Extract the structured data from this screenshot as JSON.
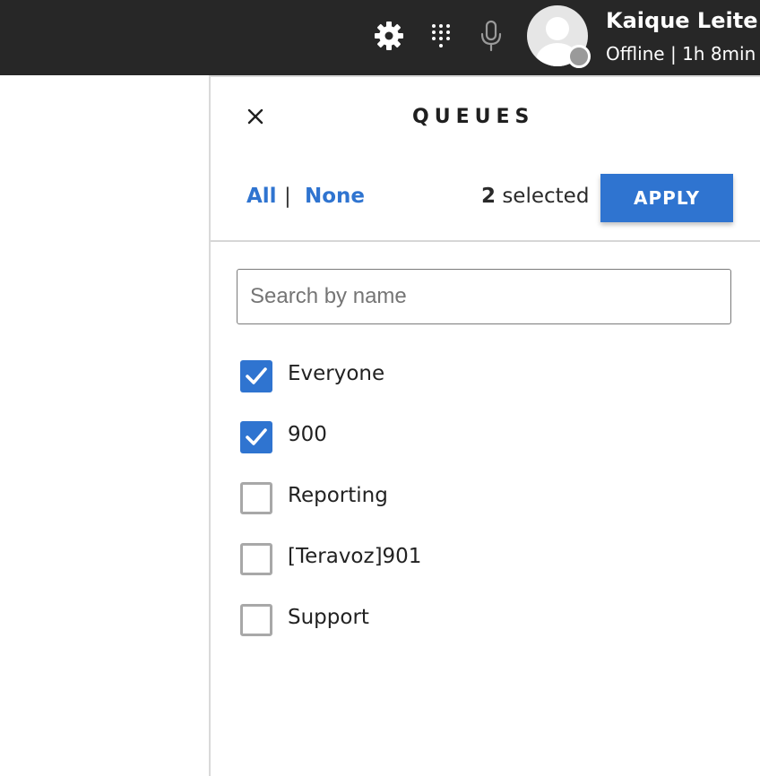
{
  "header": {
    "icons": [
      "gear-icon",
      "dialpad-icon",
      "microphone-icon"
    ],
    "user": {
      "name": "Kaique Leite",
      "status": "Offline | 1h 8min",
      "status_color": "#9a9a9a"
    }
  },
  "panel": {
    "title": "QUEUES",
    "close_icon": "close-icon",
    "select_all_label": "All",
    "separator": "|",
    "select_none_label": "None",
    "selected_count": "2",
    "selected_suffix": " selected",
    "apply_label": "APPLY",
    "search": {
      "placeholder": "Search by name",
      "value": ""
    },
    "queues": [
      {
        "label": "Everyone",
        "checked": true
      },
      {
        "label": "900",
        "checked": true
      },
      {
        "label": "Reporting",
        "checked": false
      },
      {
        "label": "[Teravoz]901",
        "checked": false
      },
      {
        "label": "Support",
        "checked": false
      }
    ]
  },
  "colors": {
    "accent": "#2f74d0",
    "topbar": "#272727"
  }
}
